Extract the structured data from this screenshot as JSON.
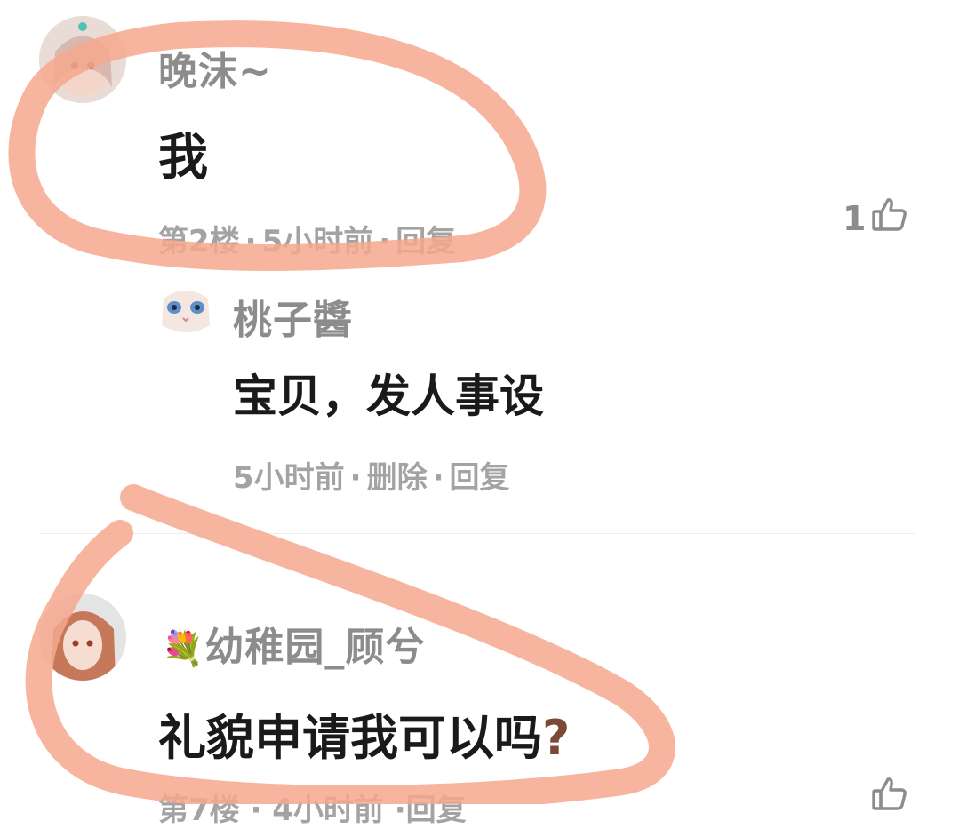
{
  "comments": [
    {
      "username": "晚沫~",
      "text": "我",
      "floor": "第2楼",
      "time": "5小时前",
      "reply": "回复",
      "likes": "1"
    },
    {
      "username": "幼稚园_顾兮",
      "username_emoji": "💐",
      "text": "礼貌申请我可以吗",
      "text_suffix": "?",
      "meta_partial": "第7楼 · 4小时前 ·回复"
    }
  ],
  "reply": {
    "username": "桃子醬",
    "text": "宝贝，发人事设",
    "time": "5小时前",
    "delete": "删除",
    "reply": "回复"
  },
  "colors": {
    "highlight_circle": "#f6a88e",
    "username": "#8c8c8c",
    "meta": "#a3a3a3",
    "text": "#1a1a1a",
    "question_mark": "#7a4a36"
  }
}
